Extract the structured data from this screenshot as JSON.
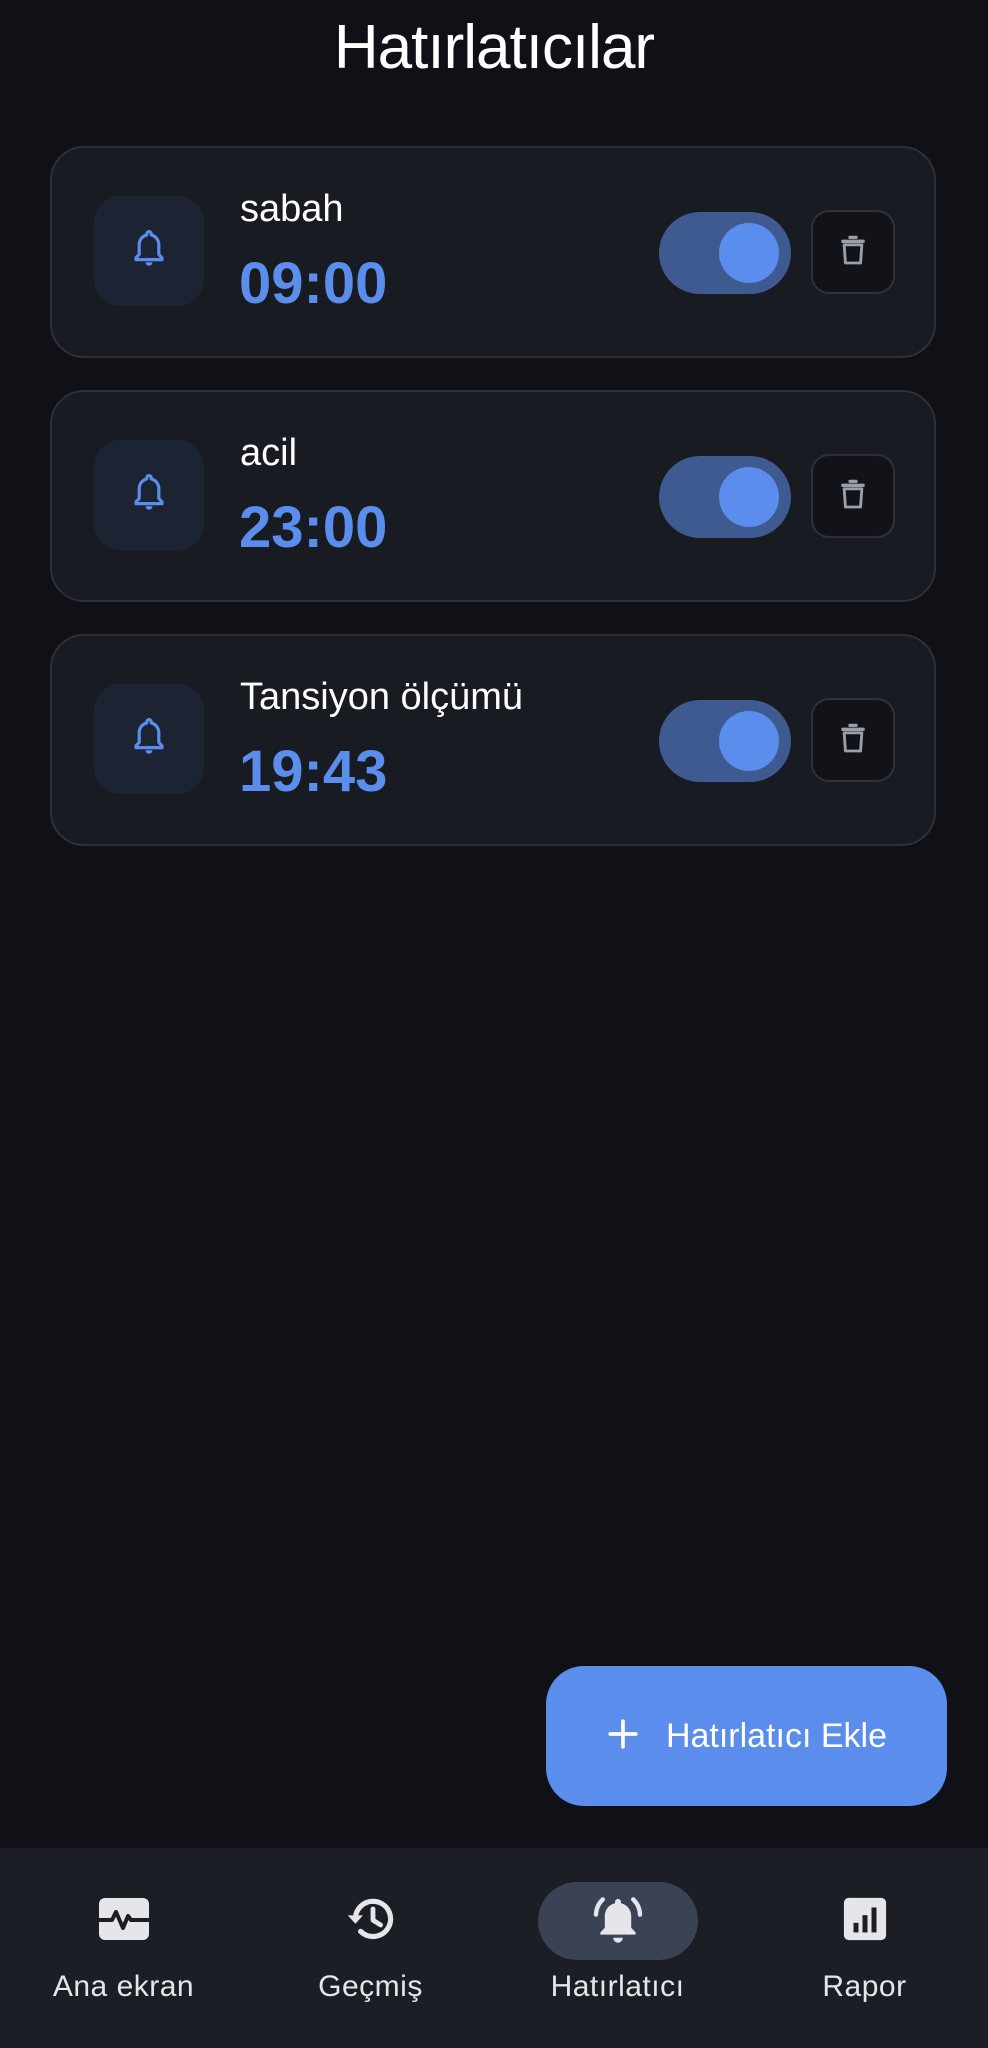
{
  "page": {
    "title": "Hatırlatıcılar"
  },
  "reminders": [
    {
      "name": "sabah",
      "time": "09:00",
      "enabled": true,
      "icon": "bell-icon",
      "delete_icon": "trash-icon"
    },
    {
      "name": "acil",
      "time": "23:00",
      "enabled": true,
      "icon": "bell-icon",
      "delete_icon": "trash-icon"
    },
    {
      "name": "Tansiyon ölçümü",
      "time": "19:43",
      "enabled": true,
      "icon": "bell-icon",
      "delete_icon": "trash-icon"
    }
  ],
  "fab": {
    "label": "Hatırlatıcı Ekle",
    "icon": "plus-icon"
  },
  "bottom_nav": {
    "items": [
      {
        "label": "Ana ekran",
        "icon": "heart-pulse-icon",
        "active": false
      },
      {
        "label": "Geçmiş",
        "icon": "history-icon",
        "active": false
      },
      {
        "label": "Hatırlatıcı",
        "icon": "bell-ringing-icon",
        "active": true
      },
      {
        "label": "Rapor",
        "icon": "bar-chart-icon",
        "active": false
      }
    ]
  },
  "colors": {
    "background": "#0f1116",
    "card": "#181b21",
    "accent": "#5b8ded",
    "toggle_track": "#3f5a90",
    "nav_background": "#1b1e24",
    "nav_active_pill": "#3a4254"
  }
}
